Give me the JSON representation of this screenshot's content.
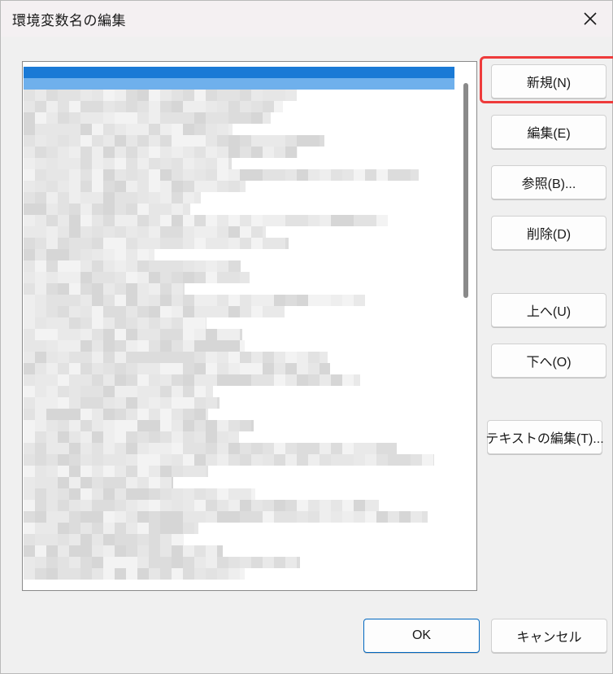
{
  "window": {
    "title": "環境変数名の編集",
    "close_icon": "close-icon"
  },
  "list": {
    "selected_index": 0,
    "rows_blurred": true
  },
  "buttons": {
    "new": "新規(N)",
    "edit": "編集(E)",
    "browse": "参照(B)...",
    "delete": "削除(D)",
    "move_up": "上へ(U)",
    "move_down": "下へ(O)",
    "edit_text": "テキストの編集(T)...",
    "ok": "OK",
    "cancel": "キャンセル"
  },
  "colors": {
    "selection": "#0a70d2",
    "highlight_box": "#ee3b3b"
  }
}
